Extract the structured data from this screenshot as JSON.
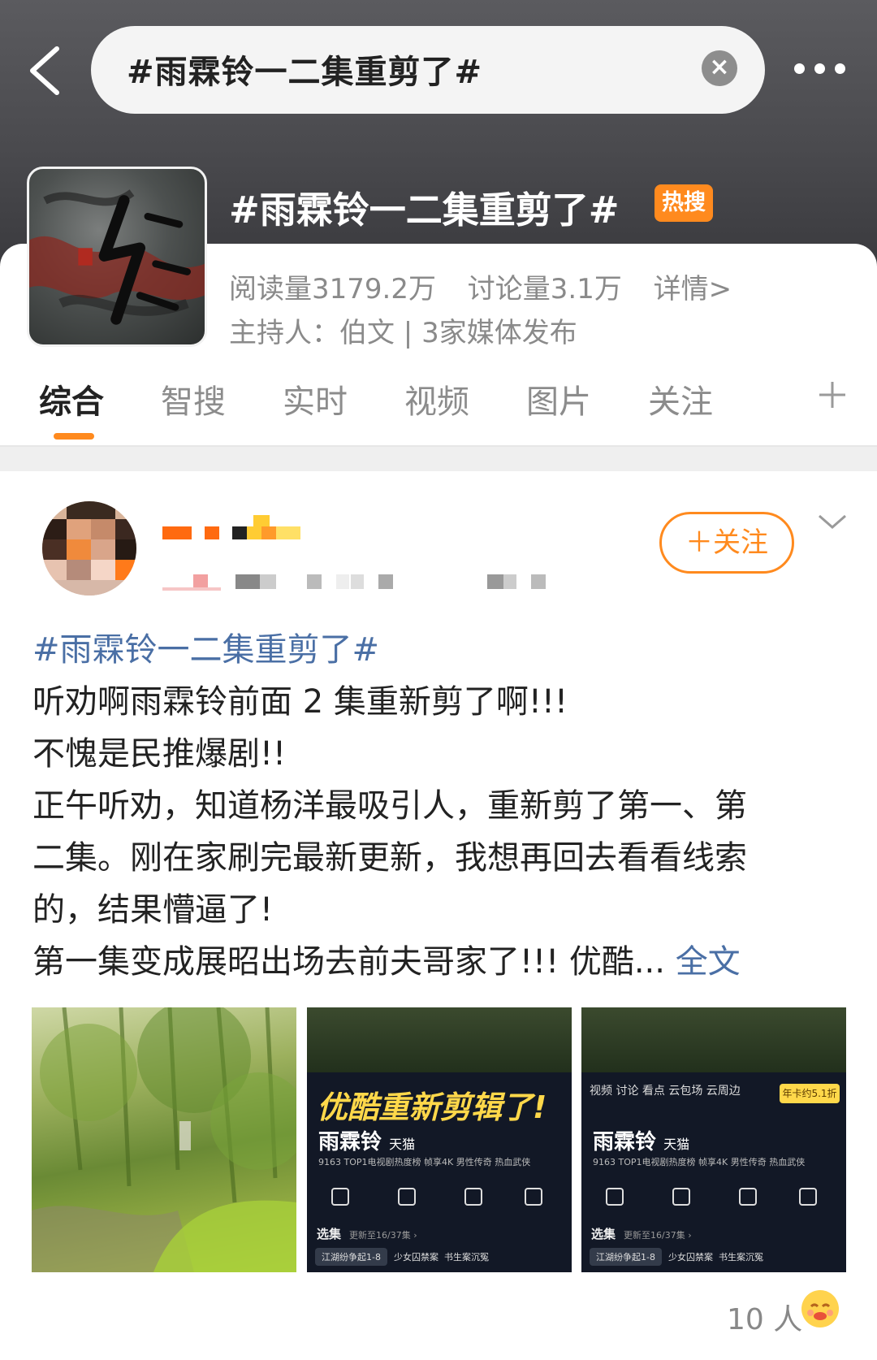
{
  "header": {
    "search_text": "#雨霖铃一二集重剪了#",
    "clear_symbol": "×"
  },
  "topic": {
    "title": "#雨霖铃一二集重剪了#",
    "hot_badge": "热搜",
    "reads": "阅读量3179.2万",
    "discussions": "讨论量3.1万",
    "details": "详情>",
    "host": "主持人：伯文 | 3家媒体发布"
  },
  "tabs": [
    {
      "label": "综合",
      "active": true
    },
    {
      "label": "智搜"
    },
    {
      "label": "实时"
    },
    {
      "label": "视频"
    },
    {
      "label": "图片"
    },
    {
      "label": "关注"
    }
  ],
  "post": {
    "follow_label": "＋关注",
    "hashtag": "#雨霖铃一二集重剪了#",
    "lines": [
      "听劝啊雨霖铃前面 2 集重新剪了啊!!!",
      "不愧是民推爆剧!!",
      "正午听劝，知道杨洋最吸引人，重新剪了第一、第",
      "二集。刚在家刷完最新更新，我想再回去看看线索",
      "的，结果懵逼了!",
      "第一集变成展昭出场去前夫哥家了!!! 优酷..."
    ],
    "full_text_link": "全文",
    "likes": "10 人"
  },
  "images": {
    "promo_text": "优酷重新剪辑了!",
    "show_logo": "雨霖铃",
    "platform": "天猫",
    "video_tabs": "视频  讨论  看点  云包场  云周边",
    "badge": "年卡约5.1折",
    "rank_text": "9163  TOP1电视剧热度榜  帧享4K  男性传奇  热血武侠",
    "episode_label": "选集",
    "episode_update": "更新至16/37集 ›",
    "episode_pills": [
      "江湖纷争起1-8",
      "少女囚禁案",
      "书生案沉冤"
    ]
  }
}
